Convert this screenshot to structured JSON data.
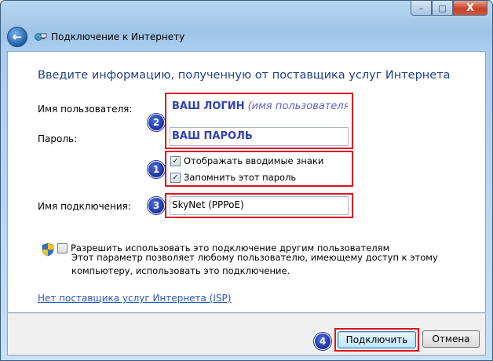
{
  "window": {
    "title": "Подключение к Интернету",
    "caption_buttons": {
      "minimize": "–",
      "maximize": "□",
      "close": "X"
    }
  },
  "heading": "Введите информацию, полученную от поставщика услуг Интернета",
  "form": {
    "username_label": "Имя пользователя:",
    "username_value": "ВАШ ЛОГИН",
    "username_hint": "(имя пользователя)",
    "password_label": "Пароль:",
    "password_value": "ВАШ ПАРОЛЬ",
    "show_chars_label": "Отображать вводимые знаки",
    "show_chars_checked": true,
    "remember_label": "Запомнить этот пароль",
    "remember_checked": true,
    "connection_name_label": "Имя подключения:",
    "connection_name_value": "SkyNet (PPPoE)",
    "allow_others_label": "Разрешить использовать это подключение другим пользователям",
    "allow_others_checked": false,
    "allow_others_desc": "Этот параметр позволяет любому пользователю, имеющему доступ к этому компьютеру, использовать это подключение.",
    "isp_link": "Нет поставщика услуг Интернета (ISP)"
  },
  "badges": {
    "b1": "1",
    "b2": "2",
    "b3": "3",
    "b4": "4"
  },
  "buttons": {
    "connect": "Подключить",
    "cancel": "Отмена"
  },
  "colors": {
    "annotation_red": "#e3101b",
    "badge_blue": "#1b2f9c",
    "heading_blue": "#1e3f8a",
    "link_blue": "#2a58b7"
  },
  "icons": {
    "back": "back-arrow-icon",
    "network": "network-globe-icon",
    "shield": "uac-shield-icon"
  }
}
